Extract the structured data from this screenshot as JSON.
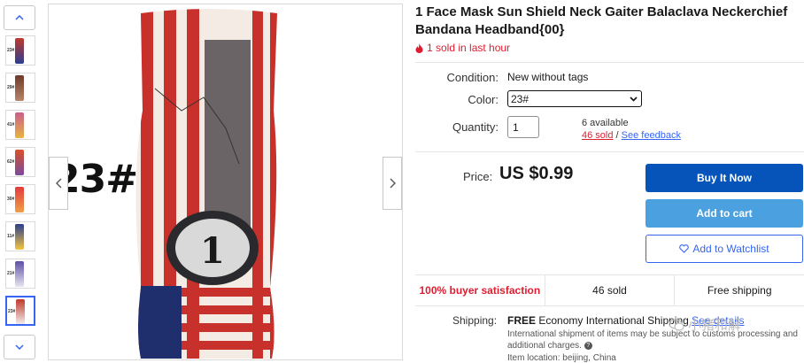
{
  "thumbnails": [
    {
      "label": "23#",
      "color_a": "#c0392b",
      "color_b": "#2c3e91",
      "selected": false
    },
    {
      "label": "29#",
      "color_a": "#6b3a2a",
      "color_b": "#b8856a",
      "selected": false
    },
    {
      "label": "41#",
      "color_a": "#c95f8b",
      "color_b": "#e9b341",
      "selected": false
    },
    {
      "label": "62#",
      "color_a": "#d8502b",
      "color_b": "#7a4b9c",
      "selected": false
    },
    {
      "label": "30#",
      "color_a": "#e23b3b",
      "color_b": "#f0a04b",
      "selected": false
    },
    {
      "label": "11#",
      "color_a": "#2b3e8e",
      "color_b": "#f4c542",
      "selected": false
    },
    {
      "label": "21#",
      "color_a": "#5d4fa8",
      "color_b": "#e6e6f0",
      "selected": false
    },
    {
      "label": "23#",
      "color_a": "#c0392b",
      "color_b": "#f3f3f3",
      "selected": true
    }
  ],
  "main_image": {
    "label": "23#"
  },
  "title": "1 Face Mask Sun Shield Neck Gaiter Balaclava Neckerchief Bandana Headband{00}",
  "sold_hint": "1 sold in last hour",
  "condition": {
    "label": "Condition:",
    "value": "New without tags"
  },
  "color": {
    "label": "Color:",
    "value": "23#"
  },
  "quantity": {
    "label": "Quantity:",
    "value": "1",
    "available": "6 available",
    "sold_link": "46 sold",
    "separator": "/",
    "feedback_link": "See feedback"
  },
  "price": {
    "label": "Price:",
    "value": "US $0.99"
  },
  "buttons": {
    "buy": "Buy It Now",
    "cart": "Add to cart",
    "watch": "Add to Watchlist"
  },
  "stats": {
    "satisfaction": "100% buyer satisfaction",
    "sold": "46 sold",
    "shipping": "Free shipping"
  },
  "shipping": {
    "label": "Shipping:",
    "free": "FREE",
    "method": "Economy International Shipping",
    "see_details": "See details",
    "note": "International shipment of items may be subject to customs processing and additional charges.",
    "location": "Item location: beijing, China"
  },
  "watermark": "小猪和解"
}
